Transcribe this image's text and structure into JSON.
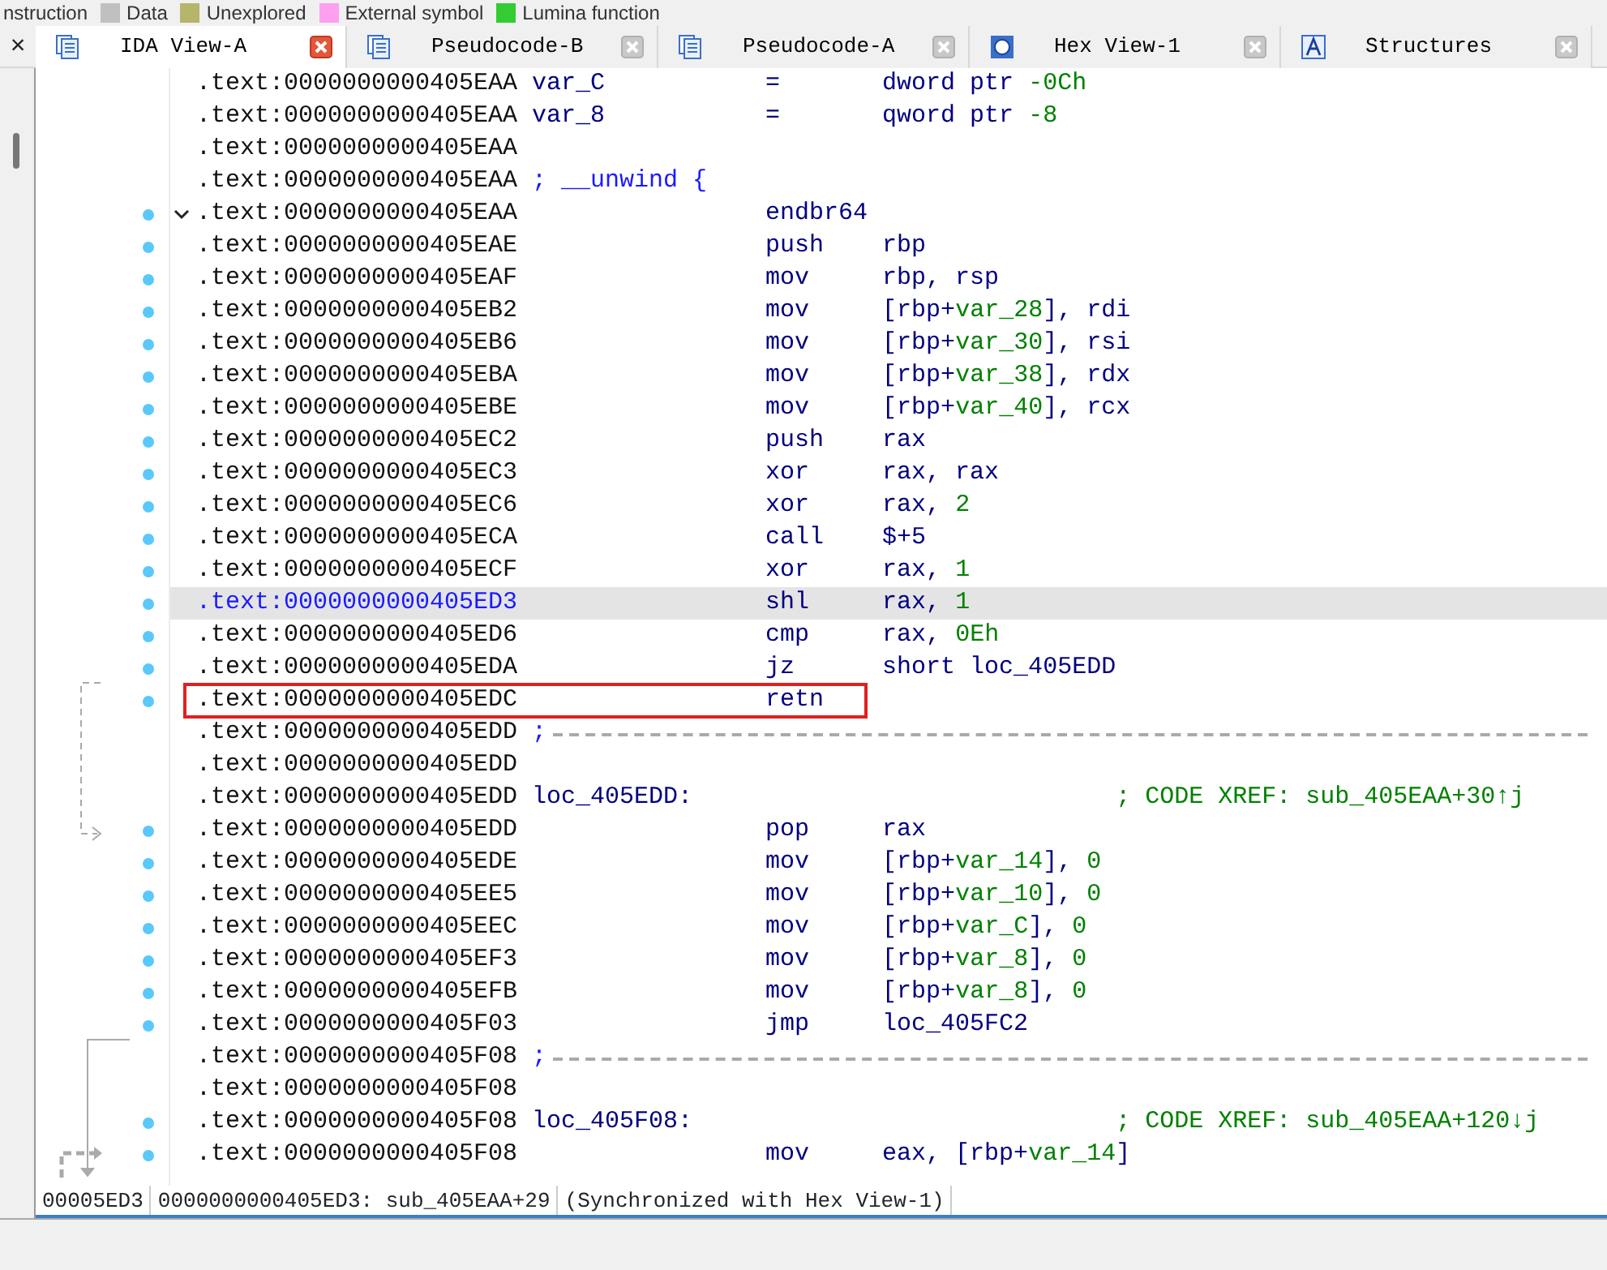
{
  "legend": [
    {
      "label": "nstruction"
    },
    {
      "label": "Data",
      "color": "#c0c0c0"
    },
    {
      "label": "Unexplored",
      "color": "#b5b56b"
    },
    {
      "label": "External symbol",
      "color": "#ff9ff0"
    },
    {
      "label": "Lumina function",
      "color": "#33cc33"
    }
  ],
  "side_close": "×",
  "tabs": [
    {
      "label": "IDA View-A",
      "selected": true,
      "kind": "listing"
    },
    {
      "label": "Pseudocode-B",
      "selected": false,
      "kind": "listing"
    },
    {
      "label": "Pseudocode-A",
      "selected": false,
      "kind": "listing"
    },
    {
      "label": "Hex View-1",
      "selected": false,
      "kind": "hex"
    },
    {
      "label": "Structures",
      "selected": false,
      "kind": "struct"
    }
  ],
  "lines": [
    {
      "kind": "instr",
      "address": ".text:0000000000405EAA",
      "label": "var_C",
      "mnemonic": "=",
      "operands": [
        {
          "t": "dword ptr ",
          "kind": "sym"
        },
        {
          "t": "-0Ch",
          "kind": "num"
        }
      ],
      "selected": false
    },
    {
      "kind": "instr",
      "address": ".text:0000000000405EAA",
      "label": "var_8",
      "mnemonic": "=",
      "operands": [
        {
          "t": "qword ptr ",
          "kind": "sym"
        },
        {
          "t": "-8",
          "kind": "num"
        }
      ],
      "selected": false
    },
    {
      "kind": "blank",
      "address": ".text:0000000000405EAA",
      "selected": false
    },
    {
      "kind": "note",
      "address": ".text:0000000000405EAA",
      "text": "; __unwind {",
      "selected": false
    },
    {
      "kind": "instr",
      "address": ".text:0000000000405EAA",
      "mnemonic": "endbr64",
      "dot": true,
      "fold": true,
      "selected": false
    },
    {
      "kind": "instr",
      "address": ".text:0000000000405EAE",
      "mnemonic": "push",
      "operands": [
        {
          "t": "rbp",
          "kind": "sym"
        }
      ],
      "dot": true,
      "selected": false
    },
    {
      "kind": "instr",
      "address": ".text:0000000000405EAF",
      "mnemonic": "mov",
      "operands": [
        {
          "t": "rbp, rsp",
          "kind": "sym"
        }
      ],
      "dot": true,
      "selected": false
    },
    {
      "kind": "instr",
      "address": ".text:0000000000405EB2",
      "mnemonic": "mov",
      "operands": [
        {
          "t": "[rbp+",
          "kind": "sym"
        },
        {
          "t": "var_28",
          "kind": "var"
        },
        {
          "t": "], rdi",
          "kind": "sym"
        }
      ],
      "dot": true,
      "selected": false
    },
    {
      "kind": "instr",
      "address": ".text:0000000000405EB6",
      "mnemonic": "mov",
      "operands": [
        {
          "t": "[rbp+",
          "kind": "sym"
        },
        {
          "t": "var_30",
          "kind": "var"
        },
        {
          "t": "], rsi",
          "kind": "sym"
        }
      ],
      "dot": true,
      "selected": false
    },
    {
      "kind": "instr",
      "address": ".text:0000000000405EBA",
      "mnemonic": "mov",
      "operands": [
        {
          "t": "[rbp+",
          "kind": "sym"
        },
        {
          "t": "var_38",
          "kind": "var"
        },
        {
          "t": "], rdx",
          "kind": "sym"
        }
      ],
      "dot": true,
      "selected": false
    },
    {
      "kind": "instr",
      "address": ".text:0000000000405EBE",
      "mnemonic": "mov",
      "operands": [
        {
          "t": "[rbp+",
          "kind": "sym"
        },
        {
          "t": "var_40",
          "kind": "var"
        },
        {
          "t": "], rcx",
          "kind": "sym"
        }
      ],
      "dot": true,
      "selected": false
    },
    {
      "kind": "instr",
      "address": ".text:0000000000405EC2",
      "mnemonic": "push",
      "operands": [
        {
          "t": "rax",
          "kind": "sym"
        }
      ],
      "dot": true,
      "selected": false
    },
    {
      "kind": "instr",
      "address": ".text:0000000000405EC3",
      "mnemonic": "xor",
      "operands": [
        {
          "t": "rax, rax",
          "kind": "sym"
        }
      ],
      "dot": true,
      "selected": false
    },
    {
      "kind": "instr",
      "address": ".text:0000000000405EC6",
      "mnemonic": "xor",
      "operands": [
        {
          "t": "rax, ",
          "kind": "sym"
        },
        {
          "t": "2",
          "kind": "num"
        }
      ],
      "dot": true,
      "selected": false
    },
    {
      "kind": "instr",
      "address": ".text:0000000000405ECA",
      "mnemonic": "call",
      "operands": [
        {
          "t": "$+5",
          "kind": "sym"
        }
      ],
      "dot": true,
      "selected": false
    },
    {
      "kind": "instr",
      "address": ".text:0000000000405ECF",
      "mnemonic": "xor",
      "operands": [
        {
          "t": "rax, ",
          "kind": "sym"
        },
        {
          "t": "1",
          "kind": "num"
        }
      ],
      "dot": true,
      "selected": false
    },
    {
      "kind": "instr",
      "address": ".text:0000000000405ED3",
      "mnemonic": "shl",
      "operands": [
        {
          "t": "rax, ",
          "kind": "sym"
        },
        {
          "t": "1",
          "kind": "num"
        }
      ],
      "dot": true,
      "selected": true
    },
    {
      "kind": "instr",
      "address": ".text:0000000000405ED6",
      "mnemonic": "cmp",
      "operands": [
        {
          "t": "rax, ",
          "kind": "sym"
        },
        {
          "t": "0Eh",
          "kind": "num"
        }
      ],
      "dot": true,
      "selected": false
    },
    {
      "kind": "instr",
      "address": ".text:0000000000405EDA",
      "mnemonic": "jz",
      "operands": [
        {
          "t": "short loc_405EDD",
          "kind": "sym"
        }
      ],
      "dot": true,
      "selected": false
    },
    {
      "kind": "instr",
      "address": ".text:0000000000405EDC",
      "mnemonic": "retn",
      "dot": true,
      "selected": false,
      "boxed": true
    },
    {
      "kind": "sep",
      "address": ".text:0000000000405EDD",
      "text": ";",
      "selected": false
    },
    {
      "kind": "blank",
      "address": ".text:0000000000405EDD",
      "selected": false
    },
    {
      "kind": "label",
      "address": ".text:0000000000405EDD",
      "label": "loc_405EDD:",
      "comment": "; CODE XREF: sub_405EAA+30↑j",
      "selected": false
    },
    {
      "kind": "instr",
      "address": ".text:0000000000405EDD",
      "mnemonic": "pop",
      "operands": [
        {
          "t": "rax",
          "kind": "sym"
        }
      ],
      "dot": true,
      "selected": false
    },
    {
      "kind": "instr",
      "address": ".text:0000000000405EDE",
      "mnemonic": "mov",
      "operands": [
        {
          "t": "[rbp+",
          "kind": "sym"
        },
        {
          "t": "var_14",
          "kind": "var"
        },
        {
          "t": "], ",
          "kind": "sym"
        },
        {
          "t": "0",
          "kind": "num"
        }
      ],
      "dot": true,
      "selected": false
    },
    {
      "kind": "instr",
      "address": ".text:0000000000405EE5",
      "mnemonic": "mov",
      "operands": [
        {
          "t": "[rbp+",
          "kind": "sym"
        },
        {
          "t": "var_10",
          "kind": "var"
        },
        {
          "t": "], ",
          "kind": "sym"
        },
        {
          "t": "0",
          "kind": "num"
        }
      ],
      "dot": true,
      "selected": false
    },
    {
      "kind": "instr",
      "address": ".text:0000000000405EEC",
      "mnemonic": "mov",
      "operands": [
        {
          "t": "[rbp+",
          "kind": "sym"
        },
        {
          "t": "var_C",
          "kind": "var"
        },
        {
          "t": "], ",
          "kind": "sym"
        },
        {
          "t": "0",
          "kind": "num"
        }
      ],
      "dot": true,
      "selected": false
    },
    {
      "kind": "instr",
      "address": ".text:0000000000405EF3",
      "mnemonic": "mov",
      "operands": [
        {
          "t": "[rbp+",
          "kind": "sym"
        },
        {
          "t": "var_8",
          "kind": "var"
        },
        {
          "t": "], ",
          "kind": "sym"
        },
        {
          "t": "0",
          "kind": "num"
        }
      ],
      "dot": true,
      "selected": false
    },
    {
      "kind": "instr",
      "address": ".text:0000000000405EFB",
      "mnemonic": "mov",
      "operands": [
        {
          "t": "[rbp+",
          "kind": "sym"
        },
        {
          "t": "var_8",
          "kind": "var"
        },
        {
          "t": "], ",
          "kind": "sym"
        },
        {
          "t": "0",
          "kind": "num"
        }
      ],
      "dot": true,
      "selected": false
    },
    {
      "kind": "instr",
      "address": ".text:0000000000405F03",
      "mnemonic": "jmp",
      "operands": [
        {
          "t": "loc_405FC2",
          "kind": "sym"
        }
      ],
      "dot": true,
      "selected": false
    },
    {
      "kind": "sep",
      "address": ".text:0000000000405F08",
      "text": ";",
      "selected": false
    },
    {
      "kind": "blank",
      "address": ".text:0000000000405F08",
      "selected": false
    },
    {
      "kind": "label",
      "address": ".text:0000000000405F08",
      "label": "loc_405F08:",
      "comment": "; CODE XREF: sub_405EAA+120↓j",
      "dot": true,
      "selected": false
    },
    {
      "kind": "instr",
      "address": ".text:0000000000405F08",
      "mnemonic": "mov",
      "operands": [
        {
          "t": "eax, [rbp+",
          "kind": "sym"
        },
        {
          "t": "var_14",
          "kind": "var"
        },
        {
          "t": "]",
          "kind": "sym"
        }
      ],
      "dot": true,
      "selected": false
    }
  ],
  "status": [
    "00005ED3",
    "0000000000405ED3: sub_405EAA+29",
    "(Synchronized with Hex View-1)"
  ]
}
